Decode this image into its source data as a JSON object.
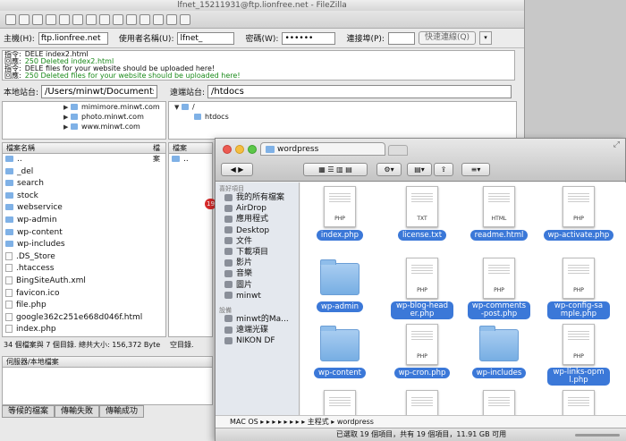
{
  "filezilla": {
    "title": "lfnet_15211931@ftp.lionfree.net - FileZilla",
    "quickconnect": {
      "host_label": "主機(H):",
      "host_value": "ftp.lionfree.net",
      "user_label": "使用者名稱(U):",
      "user_value": "lfnet_",
      "pass_label": "密碼(W):",
      "pass_value": "••••••",
      "port_label": "連接埠(P):",
      "port_value": "",
      "connect_button": "快速連線(Q)",
      "dropdown_icon": "chevron-down-icon"
    },
    "log": [
      {
        "prefix": "指令:",
        "text": "DELE index2.html",
        "ok": false
      },
      {
        "prefix": "回應:",
        "text": "250 Deleted index2.html",
        "ok": true
      },
      {
        "prefix": "指令:",
        "text": "DELE files for your website should be uploaded here!",
        "ok": false
      },
      {
        "prefix": "回應:",
        "text": "250 Deleted files for your website should be uploaded here!",
        "ok": true
      }
    ],
    "local_site_label": "本地站台:",
    "local_site_path": "/Users/minwt/Documents/f",
    "remote_site_label": "遠端站台:",
    "remote_site_path": "/htdocs",
    "local_tree": [
      "mimimore.minwt.com",
      "photo.minwt.com",
      "www.minwt.com"
    ],
    "remote_tree": [
      "/",
      "htdocs"
    ],
    "local_header": "檔案名稱",
    "local_header2": "檔案",
    "remote_header": "檔案",
    "local_files": [
      {
        "name": "..",
        "folder": true
      },
      {
        "name": "_del",
        "folder": true
      },
      {
        "name": "search",
        "folder": true
      },
      {
        "name": "stock",
        "folder": true
      },
      {
        "name": "webservice",
        "folder": true
      },
      {
        "name": "wp-admin",
        "folder": true
      },
      {
        "name": "wp-content",
        "folder": true
      },
      {
        "name": "wp-includes",
        "folder": true
      },
      {
        "name": ".DS_Store",
        "folder": false
      },
      {
        "name": ".htaccess",
        "folder": false
      },
      {
        "name": "BingSiteAuth.xml",
        "folder": false
      },
      {
        "name": "favicon.ico",
        "folder": false
      },
      {
        "name": "file.php",
        "folder": false
      },
      {
        "name": "google362c251e668d046f.html",
        "folder": false
      },
      {
        "name": "index.php",
        "folder": false
      }
    ],
    "remote_files": [
      ".."
    ],
    "local_status": "34 個檔案與 7 個目錄. 總共大小: 156,372 Byte",
    "remote_status": "空目錄.",
    "queue_header": "伺服器/本地檔案",
    "queue_tabs": [
      "等候的檔案",
      "傳輸失敗",
      "傳輸成功"
    ]
  },
  "drag_items": [
    "index.php",
    "license.txt",
    "readme.html",
    "wp-activate.php",
    "wp-admin",
    "wp-blog-head...",
    "wp-comments...",
    "wp-config-sa...",
    "wp-content",
    "wp-cron.php"
  ],
  "drag_badge": "19",
  "finder": {
    "tab_title": "wordpress",
    "toolbar_icons": [
      "back-icon",
      "forward-icon",
      "icon-view-icon",
      "list-view-icon",
      "column-view-icon",
      "coverflow-view-icon",
      "action-gear-icon",
      "arrange-icon",
      "share-icon",
      "sort-icon"
    ],
    "sidebar": {
      "favorites_header": "喜好項目",
      "favorites": [
        "我的所有檔案",
        "AirDrop",
        "應用程式",
        "Desktop",
        "文件",
        "下載項目",
        "影片",
        "音樂",
        "圖片",
        "minwt"
      ],
      "devices_header": "設備",
      "devices": [
        "minwt的Ma...",
        "遠端光碟",
        "NIKON DF"
      ]
    },
    "files": [
      {
        "name": "index.php",
        "type": "PHP",
        "kind": "doc"
      },
      {
        "name": "license.txt",
        "type": "TXT",
        "kind": "doc"
      },
      {
        "name": "readme.html",
        "type": "HTML",
        "kind": "doc"
      },
      {
        "name": "wp-activate.php",
        "type": "PHP",
        "kind": "doc"
      },
      {
        "name": "wp-admin",
        "type": "",
        "kind": "folder"
      },
      {
        "name": "wp-blog-header.php",
        "type": "PHP",
        "kind": "doc"
      },
      {
        "name": "wp-comments-post.php",
        "type": "PHP",
        "kind": "doc"
      },
      {
        "name": "wp-config-sample.php",
        "type": "PHP",
        "kind": "doc"
      },
      {
        "name": "wp-content",
        "type": "",
        "kind": "folder"
      },
      {
        "name": "wp-cron.php",
        "type": "PHP",
        "kind": "doc"
      },
      {
        "name": "wp-includes",
        "type": "",
        "kind": "folder"
      },
      {
        "name": "wp-links-opml.php",
        "type": "PHP",
        "kind": "doc"
      },
      {
        "name": "",
        "type": "",
        "kind": "doc"
      },
      {
        "name": "",
        "type": "",
        "kind": "doc"
      },
      {
        "name": "",
        "type": "",
        "kind": "doc"
      },
      {
        "name": "",
        "type": "",
        "kind": "doc"
      }
    ],
    "path_bar": "MAC OS  ▸  ▸  ▸  ▸  ▸  ▸  ▸  ▸ 主程式 ▸ wordpress",
    "status": "已選取 19 個項目，共有 19 個項目，11.91 GB 可用"
  }
}
